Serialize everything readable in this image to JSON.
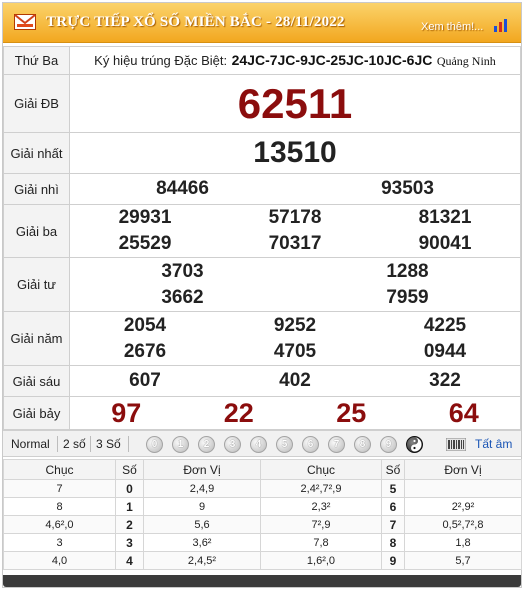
{
  "header": {
    "title": "TRỰC TIẾP XỔ SỐ MIỀN BẮC - 28/11/2022",
    "more_link": "Xem thêm!...",
    "colors": {
      "header_bg": "#f2a71f",
      "prize_red": "#8b0d0d",
      "link_blue": "#1a55b5"
    }
  },
  "results": {
    "day": "Thứ Ba",
    "code_label": "Ký hiệu trúng Đặc Biệt:",
    "code": "24JC-7JC-9JC-25JC-10JC-6JC",
    "province": "Quảng Ninh",
    "prizes": [
      {
        "label": "Giải ĐB",
        "numbers": [
          "62511"
        ]
      },
      {
        "label": "Giải nhất",
        "numbers": [
          "13510"
        ]
      },
      {
        "label": "Giải nhì",
        "numbers": [
          "84466",
          "93503"
        ]
      },
      {
        "label": "Giải ba",
        "numbers": [
          "29931",
          "57178",
          "81321",
          "25529",
          "70317",
          "90041"
        ]
      },
      {
        "label": "Giải tư",
        "numbers": [
          "3703",
          "1288",
          "3662",
          "7959"
        ]
      },
      {
        "label": "Giải năm",
        "numbers": [
          "2054",
          "9252",
          "4225",
          "2676",
          "4705",
          "0944"
        ]
      },
      {
        "label": "Giải sáu",
        "numbers": [
          "607",
          "402",
          "322"
        ]
      },
      {
        "label": "Giải bảy",
        "numbers": [
          "97",
          "22",
          "25",
          "64"
        ]
      }
    ]
  },
  "toolbar": {
    "normal": "Normal",
    "two_digits": "2 số",
    "three_digits": "3 Số",
    "digits": [
      "0",
      "1",
      "2",
      "3",
      "4",
      "5",
      "6",
      "7",
      "8",
      "9"
    ],
    "all_label": "Tất âm"
  },
  "loto": {
    "headers": [
      "Chục",
      "Số",
      "Đơn Vị",
      "Chục",
      "Số",
      "Đơn Vị"
    ],
    "rows": [
      {
        "c1": "7",
        "n1": "0",
        "d1": "2,4,9",
        "c2": "2,4²,7²,9",
        "n2": "5",
        "d2": ""
      },
      {
        "c1": "8",
        "n1": "1",
        "d1": "9",
        "c2": "2,3²",
        "n2": "6",
        "d2": "2²,9²"
      },
      {
        "c1": "4,6²,0",
        "n1": "2",
        "d1": "5,6",
        "c2": "7²,9",
        "n2": "7",
        "d2": "0,5²,7²,8"
      },
      {
        "c1": "3",
        "n1": "3",
        "d1": "3,6²",
        "c2": "7,8",
        "n2": "8",
        "d2": "1,8"
      },
      {
        "c1": "4,0",
        "n1": "4",
        "d1": "2,4,5²",
        "c2": "1,6²,0",
        "n2": "9",
        "d2": "5,7"
      }
    ]
  }
}
